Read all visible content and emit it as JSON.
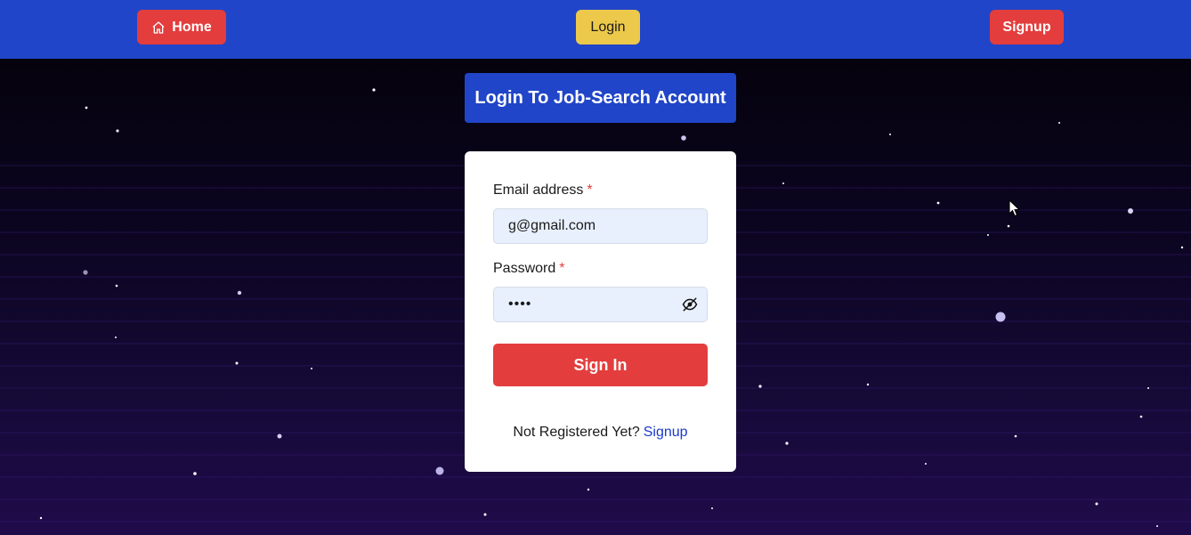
{
  "navbar": {
    "home_label": "Home",
    "login_label": "Login",
    "signup_label": "Signup"
  },
  "heading": "Login To Job-Search Account",
  "form": {
    "email_label": "Email address",
    "email_value": "g@gmail.com",
    "password_label": "Password",
    "password_value": "••••",
    "required_marker": "*",
    "submit_label": "Sign In",
    "register_prompt": "Not Registered Yet?",
    "register_link": "Signup"
  },
  "icons": {
    "home": "home-icon",
    "password_toggle": "eye-off-icon"
  },
  "colors": {
    "navbar": "#2145c8",
    "danger": "#e33d3d",
    "warning": "#ecc94b",
    "input_bg": "#e8f0fe",
    "link": "#1a3acb"
  }
}
